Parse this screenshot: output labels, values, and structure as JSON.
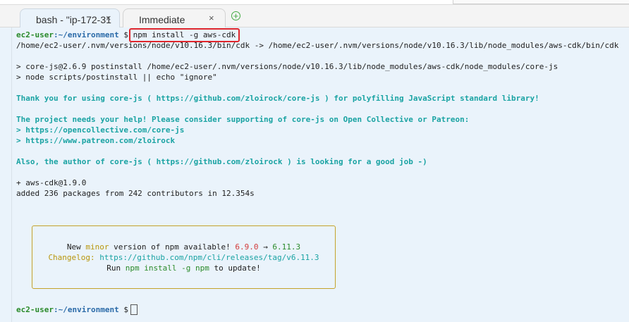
{
  "tabs": [
    {
      "label": "bash - \"ip-172-31",
      "close": "×"
    },
    {
      "label": "Immediate",
      "close": "×"
    }
  ],
  "add_tab_symbol": "+",
  "prompt": {
    "user": "ec2-user",
    "path": ":~/environment",
    "symbol": "$"
  },
  "command": "npm install -g aws-cdk",
  "output": {
    "symlink": "/home/ec2-user/.nvm/versions/node/v10.16.3/bin/cdk -> /home/ec2-user/.nvm/versions/node/v10.16.3/lib/node_modules/aws-cdk/bin/cdk",
    "postinstall_1": "> core-js@2.6.9 postinstall /home/ec2-user/.nvm/versions/node/v10.16.3/lib/node_modules/aws-cdk/node_modules/core-js",
    "postinstall_2": "> node scripts/postinstall || echo \"ignore\"",
    "thanks": "Thank you for using core-js ( https://github.com/zloirock/core-js ) for polyfilling JavaScript standard library!",
    "help": "The project needs your help! Please consider supporting of core-js on Open Collective or Patreon:",
    "link_1": "> https://opencollective.com/core-js",
    "link_2": "> https://www.patreon.com/zloirock",
    "author": "Also, the author of core-js ( https://github.com/zloirock ) is looking for a good job -)",
    "installed": "+ aws-cdk@1.9.0",
    "added": "added 236 packages from 242 contributors in 12.354s"
  },
  "notice": {
    "line1_pre": "New ",
    "line1_minor": "minor",
    "line1_mid": " version of npm available! ",
    "line1_old": "6.9.0",
    "line1_arrow": " → ",
    "line1_new": "6.11.3",
    "changelog_label": "Changelog:",
    "changelog_url": " https://github.com/npm/cli/releases/tag/v6.11.3",
    "run_pre": "Run ",
    "run_cmd": "npm install -g npm",
    "run_post": " to update!"
  },
  "colors": {
    "background": "#eaf3fb",
    "highlight_box": "#e0262c",
    "prompt_user": "#2a8a2a",
    "prompt_path": "#2a6aa8",
    "teal_text": "#1aa3a3",
    "notice_border": "#c4a22a"
  }
}
